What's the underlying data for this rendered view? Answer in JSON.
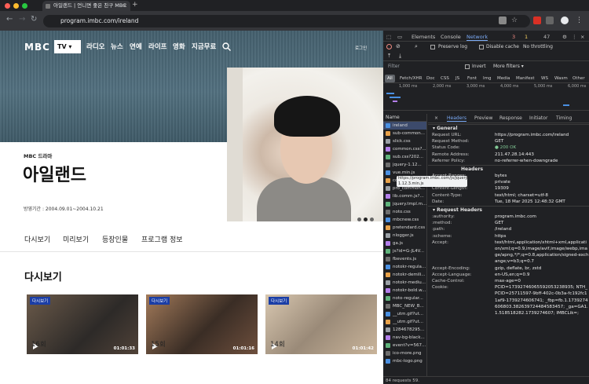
{
  "browser": {
    "tab_title": "아일랜드 | 언니면 좋은 친구 MBC",
    "new_tab": "+",
    "url": "program.imbc.com/ireland",
    "nav_back": "←",
    "nav_forward": "→",
    "nav_reload": "↻"
  },
  "site": {
    "logo": "MBC",
    "tv_select": "TV ▾",
    "menu": [
      "라디오",
      "뉴스",
      "연예",
      "라이프",
      "영화",
      "지금무료"
    ],
    "login": "로그인",
    "program_category": "MBC 드라마",
    "program_title": "아일랜드",
    "broadcast_period": "방영기간 : 2004.09.01~2004.10.21",
    "tabs": [
      "다시보기",
      "미리보기",
      "등장인물",
      "프로그램 정보"
    ],
    "section_title": "다시보기",
    "episodes": [
      {
        "badge": "다시보기",
        "duration": "01:01:33",
        "label": "16회"
      },
      {
        "badge": "다시보기",
        "duration": "01:01:16",
        "label": "15회"
      },
      {
        "badge": "다시보기",
        "duration": "01:01:42",
        "label": "14회"
      }
    ]
  },
  "devtools": {
    "tabs": [
      "Elements",
      "Console",
      "Network"
    ],
    "active_tab": "Network",
    "counts": {
      "errors": "3",
      "warnings": "1",
      "info": "47"
    },
    "preserve_log": "Preserve log",
    "disable_cache": "Disable cache",
    "throttling": "No throttling",
    "filter_placeholder": "Filter",
    "invert": "Invert",
    "more_filters": "More filters ▾",
    "type_filters": [
      "All",
      "Fetch/XHR",
      "Doc",
      "CSS",
      "JS",
      "Font",
      "Img",
      "Media",
      "Manifest",
      "WS",
      "Wasm",
      "Other"
    ],
    "timeline_labels": [
      "1,000 ms",
      "2,000 ms",
      "3,000 ms",
      "4,000 ms",
      "5,000 ms",
      "6,000 ms"
    ],
    "name_header": "Name",
    "files": [
      "ireland",
      "sub-common...",
      "slick.css",
      "common.css?...",
      "sub.css?202...",
      "jquery-1.12...",
      "vue.min.js",
      "common.js?...",
      "pro_common...",
      "lib.comm.js?...",
      "jquery.tmpl.m...",
      "noto.css",
      "mbcnew.css",
      "pretendard.css",
      "nlogger.js",
      "ga.js",
      "js?id=G-JL4V...",
      "fbevents.js",
      "notokr-regula...",
      "notokr-demili...",
      "notokr-mediu...",
      "notokr-bold.w...",
      "noto-regular...",
      "MBC_NEW_B...",
      "__utm.gif?ut...",
      "__utm.gif?ut...",
      "1284678295...",
      "nav-bg-black...",
      "event?v=567...",
      "ico-more.png",
      "mbc-logo.png"
    ],
    "tooltip": "https://program.imbc.com/js/jquery-1.12.3.min.js",
    "header_tabs": [
      "Headers",
      "Preview",
      "Response",
      "Initiator",
      "Timing"
    ],
    "general_title": "▾ General",
    "general": [
      {
        "k": "Request URL:",
        "v": "https://program.imbc.com/ireland"
      },
      {
        "k": "Request Method:",
        "v": "GET"
      },
      {
        "k": "Status Code:",
        "v": "● 200 OK"
      },
      {
        "k": "Remote Address:",
        "v": "211.47.28.14:443"
      },
      {
        "k": "Referrer Policy:",
        "v": "no-referrer-when-downgrade"
      }
    ],
    "response_title": "Headers",
    "response": [
      {
        "k": "Accept-Ranges:",
        "v": "bytes"
      },
      {
        "k": "Cache-Control:",
        "v": "private"
      },
      {
        "k": "Content-Length:",
        "v": "19309"
      },
      {
        "k": "Content-Type:",
        "v": "text/html; charset=utf-8"
      },
      {
        "k": "Date:",
        "v": "Tue, 18 Mar 2025 12:48:32 GMT"
      }
    ],
    "request_title": "▾ Request Headers",
    "request": [
      {
        "k": ":authority:",
        "v": "program.imbc.com"
      },
      {
        "k": ":method:",
        "v": "GET"
      },
      {
        "k": ":path:",
        "v": "/ireland"
      },
      {
        "k": ":scheme:",
        "v": "https"
      },
      {
        "k": "Accept:",
        "v": "text/html,application/xhtml+xml,application/xml;q=0.9,image/avif,image/webp,image/apng,*/*;q=0.8,application/signed-exchange;v=b3;q=0.7"
      },
      {
        "k": "Accept-Encoding:",
        "v": "gzip, deflate, br, zstd"
      },
      {
        "k": "Accept-Language:",
        "v": "en-US,en;q=0.9"
      },
      {
        "k": "Cache-Control:",
        "v": "max-age=0"
      },
      {
        "k": "Cookie:",
        "v": "PCID=17392746065592053238935; NTH_PCID=25711597-9bff-402c-0b3a-fc192fc11af9-1739274606741; _fbp=fb.1.1739274606803.382639724484583457; _ga=GA1.1.518518282.1739274607; IMBCLik=;"
      }
    ],
    "status_bar": "84 requests  59."
  }
}
